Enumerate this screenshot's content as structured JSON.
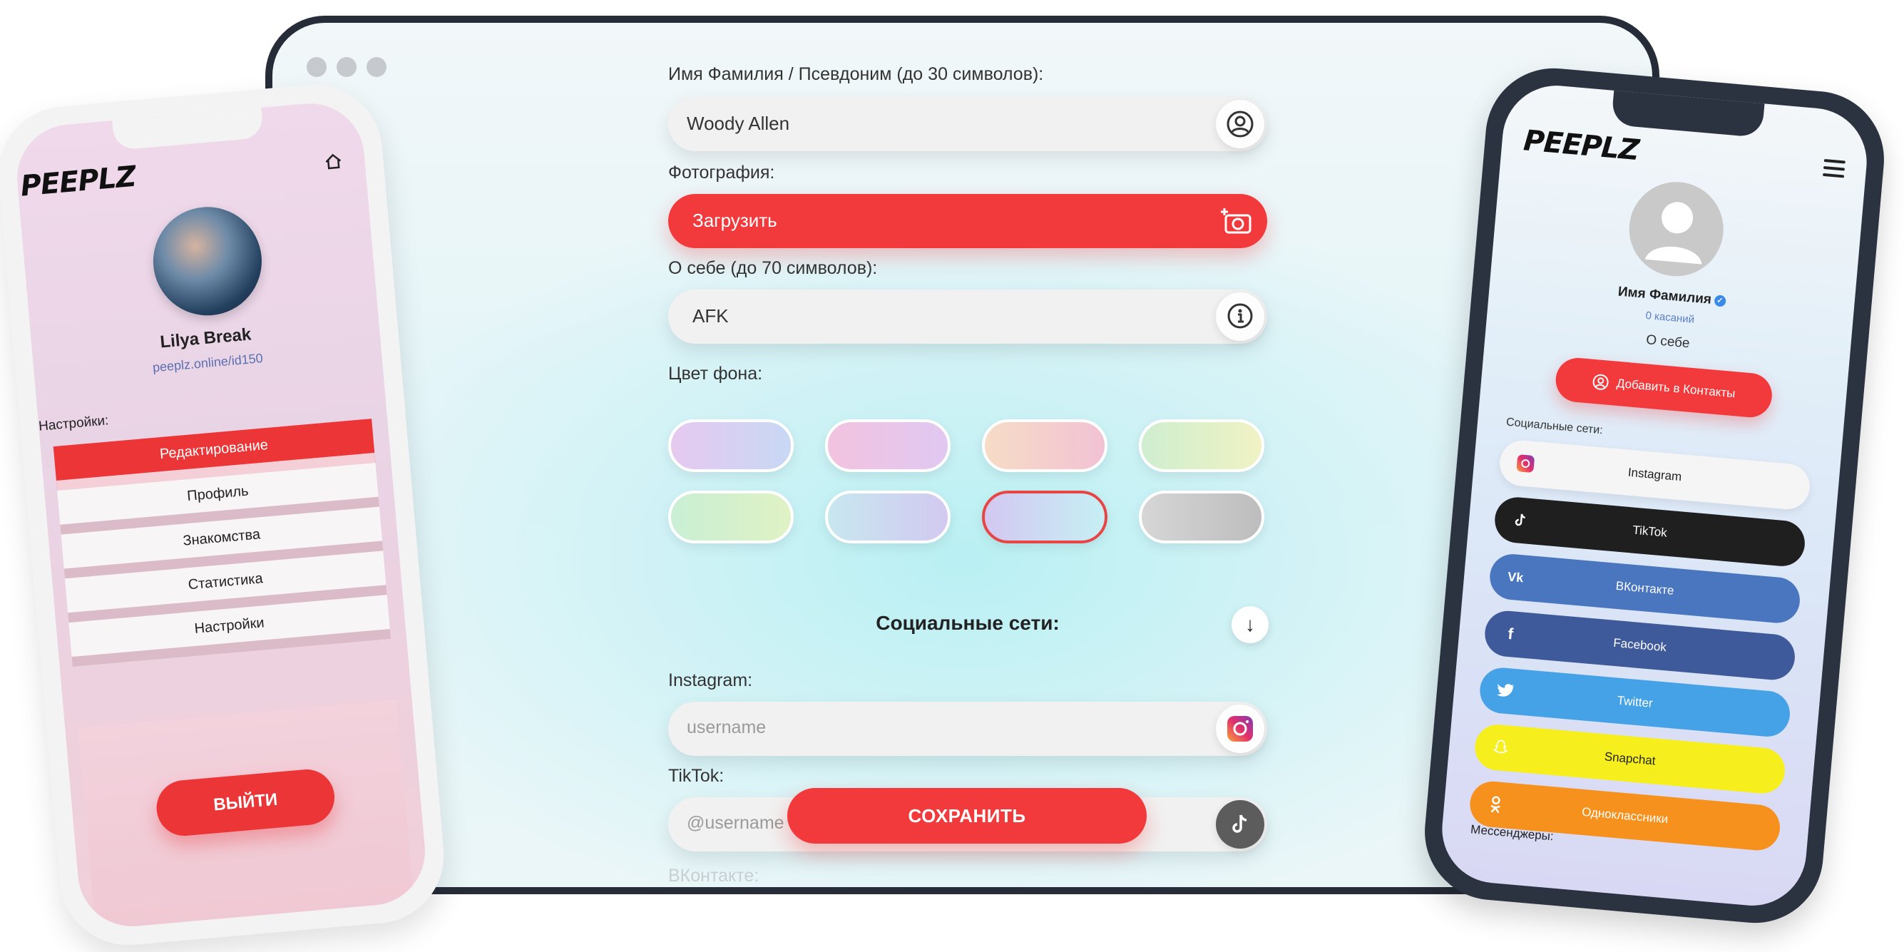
{
  "tablet": {
    "form": {
      "name_label": "Имя Фамилия / Псевдоним (до 30 символов):",
      "name_value": "Woody Allen",
      "photo_label": "Фотография:",
      "upload_label": "Загрузить",
      "about_label": "О себе (до 70 символов):",
      "about_value": "AFK",
      "bg_color_label": "Цвет фона:",
      "swatches": [
        {
          "colors": [
            "#e6c9f0",
            "#c8d8f4"
          ],
          "selected": false
        },
        {
          "colors": [
            "#f2c3df",
            "#e1c8f1"
          ],
          "selected": false
        },
        {
          "colors": [
            "#f6dcc6",
            "#f2c2d4"
          ],
          "selected": false
        },
        {
          "colors": [
            "#cfeed0",
            "#f0f2c3"
          ],
          "selected": false
        },
        {
          "colors": [
            "#c9efd4",
            "#dff2c4"
          ],
          "selected": false
        },
        {
          "colors": [
            "#c8e7ef",
            "#d2c9f0"
          ],
          "selected": false
        },
        {
          "colors": [
            "#d3c8f1",
            "#c6eff4"
          ],
          "selected": true
        },
        {
          "colors": [
            "#d6d6d6",
            "#bdbdbd"
          ],
          "selected": false
        }
      ],
      "social_title": "Социальные сети:",
      "arrow_glyph": "↓",
      "instagram_label": "Instagram:",
      "instagram_placeholder": "username",
      "tiktok_label": "TikTok:",
      "tiktok_placeholder": "@username",
      "vk_label": "ВКонтакте:",
      "save_label": "СОХРАНИТЬ"
    }
  },
  "left_phone": {
    "logo": "PEEPLZ",
    "profile_name": "Lilya Break",
    "profile_link": "peeplz.online/id150",
    "settings_label": "Настройки:",
    "menu": [
      "Редактирование",
      "Профиль",
      "Знакомства",
      "Статистика",
      "Настройки"
    ],
    "active_index": 0,
    "logout_label": "ВЫЙТИ"
  },
  "right_phone": {
    "logo": "PEEPLZ",
    "profile_name": "Имя Фамилия",
    "touches": "0 касаний",
    "about": "О себе",
    "add_contact_label": "Добавить в Контакты",
    "social_label": "Социальные сети:",
    "social_links": [
      {
        "label": "Instagram",
        "bg": "#f5f5f5",
        "fg": "#222",
        "icon": "instagram-icon"
      },
      {
        "label": "TikTok",
        "bg": "#1f1f1f",
        "fg": "#ffffff",
        "icon": "tiktok-icon"
      },
      {
        "label": "ВКонтакте",
        "bg": "#4a76c0",
        "fg": "#ffffff",
        "icon": "vk-icon"
      },
      {
        "label": "Facebook",
        "bg": "#3f5a9a",
        "fg": "#ffffff",
        "icon": "facebook-icon"
      },
      {
        "label": "Twitter",
        "bg": "#46a2e6",
        "fg": "#ffffff",
        "icon": "twitter-icon"
      },
      {
        "label": "Snapchat",
        "bg": "#f6ef1d",
        "fg": "#222",
        "icon": "snapchat-icon"
      },
      {
        "label": "Одноклассники",
        "bg": "#f6911d",
        "fg": "#ffffff",
        "icon": "odnoklassniki-icon"
      }
    ],
    "messengers_label": "Мессенджеры:"
  },
  "colors": {
    "accent_red": "#f2393b",
    "device_dark": "#262c38"
  }
}
